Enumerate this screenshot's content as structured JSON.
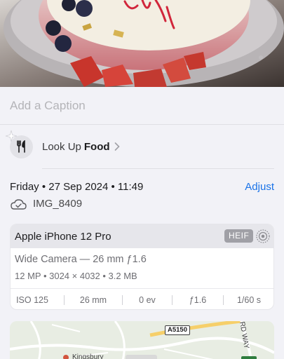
{
  "caption": {
    "placeholder": "Add a Caption"
  },
  "lookup": {
    "prefix": "Look Up",
    "subject": "Food"
  },
  "info": {
    "date": "Friday • 27 Sep 2024 • 11:49",
    "adjust_label": "Adjust",
    "filename": "IMG_8409"
  },
  "camera": {
    "device": "Apple iPhone 12 Pro",
    "format_badge": "HEIF",
    "lens": "Wide Camera — 26 mm ƒ1.6",
    "specs": "12 MP  •  3024 × 4032  •  3.2 MB",
    "exif": [
      "ISO 125",
      "26 mm",
      "0 ev",
      "ƒ1.6",
      "1/60 s"
    ]
  },
  "map": {
    "road_badge": "A5150",
    "road_name": "RD WAY",
    "place": "Kingsbury"
  },
  "colors": {
    "accent": "#1a73e8",
    "sheet": "#f2f2f7"
  }
}
